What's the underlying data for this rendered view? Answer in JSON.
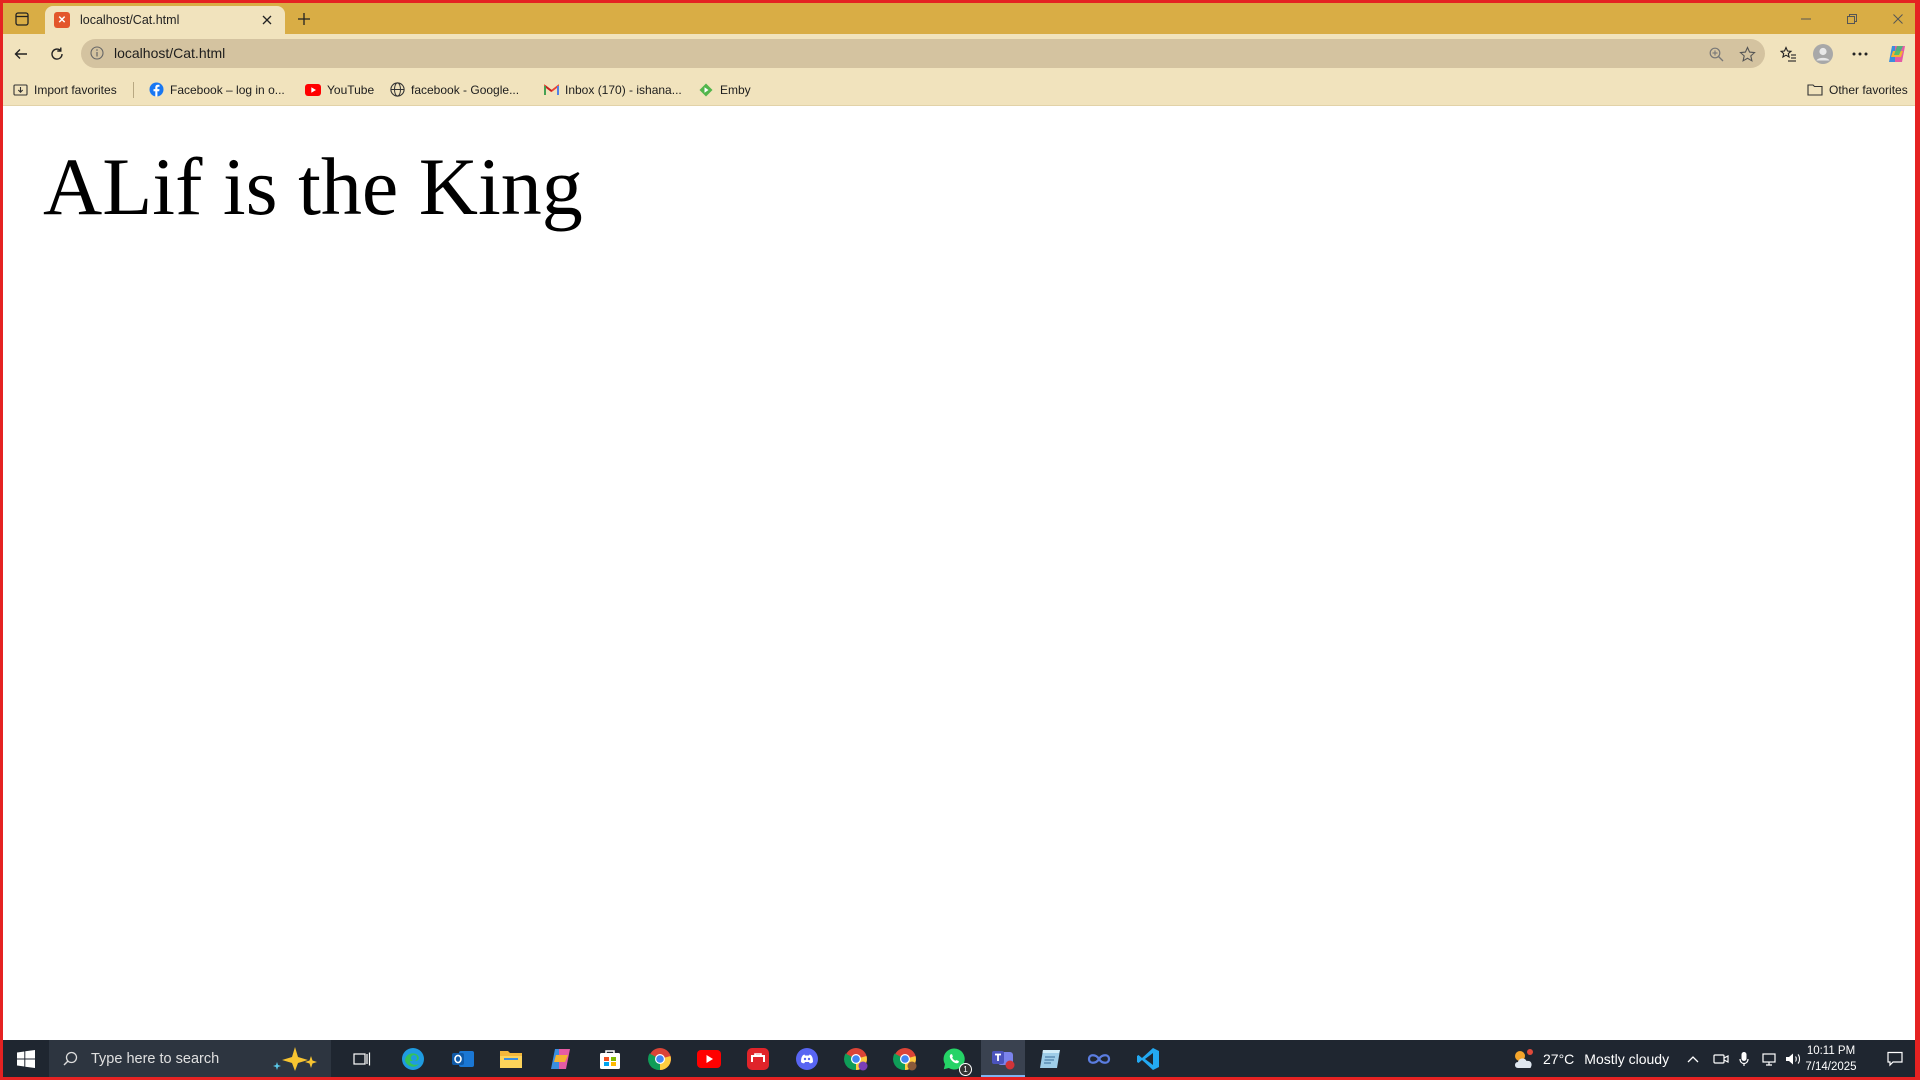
{
  "browser": {
    "tab": {
      "title": "localhost/Cat.html"
    },
    "address": {
      "url": "localhost/Cat.html"
    },
    "favorites": [
      {
        "label": "Import favorites",
        "icon": "import-favorites-icon"
      },
      {
        "label": "Facebook – log in o...",
        "icon": "facebook-icon"
      },
      {
        "label": "YouTube",
        "icon": "youtube-icon"
      },
      {
        "label": "facebook - Google...",
        "icon": "globe-icon"
      },
      {
        "label": "Inbox (170) - ishana...",
        "icon": "gmail-icon"
      },
      {
        "label": "Emby",
        "icon": "emby-icon"
      }
    ],
    "other_favorites": "Other favorites"
  },
  "page": {
    "heading": "ALif is the King"
  },
  "taskbar": {
    "search_placeholder": "Type here to search",
    "whatsapp_badge": "1",
    "weather": {
      "temp": "27°C",
      "condition": "Mostly cloudy"
    },
    "clock": {
      "time": "10:11 PM",
      "date": "7/14/2025"
    }
  },
  "colors": {
    "tabstrip": "#d9ad45",
    "toolbar": "#f1e3bd",
    "omnibox": "#d4c3a0",
    "taskbar": "#1f2630",
    "frame": "#e52222"
  }
}
